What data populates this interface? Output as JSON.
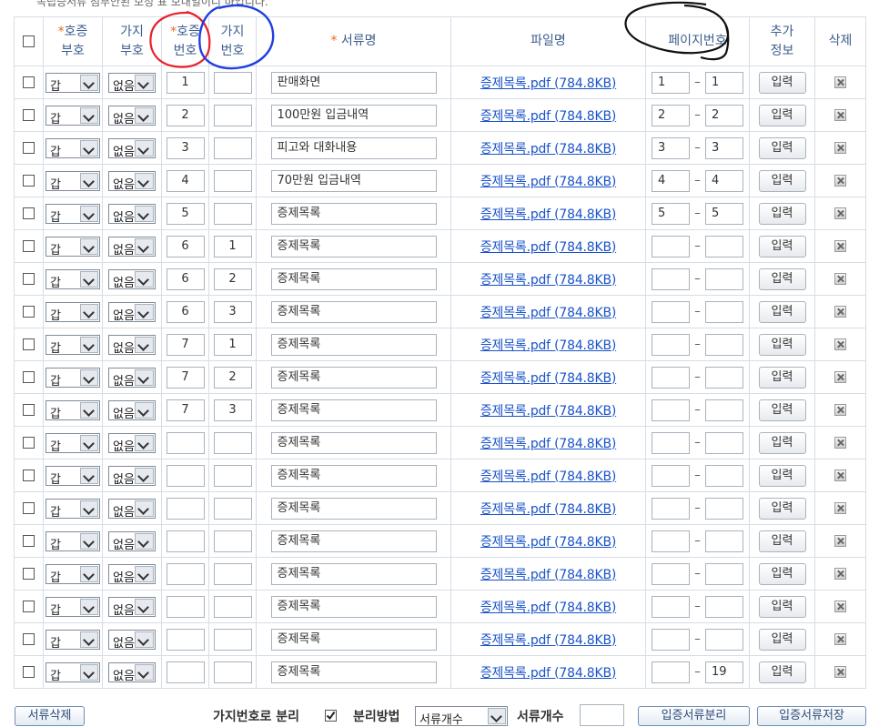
{
  "cutoff_text": "녹립증서류 첨부안된 보정 표 보내일이니 마입니다.",
  "columns": {
    "select_all": "",
    "code_prefix_req": "*",
    "code": [
      "호증",
      "부호"
    ],
    "branch_code": [
      "가지",
      "부호"
    ],
    "number_req": "*",
    "number": [
      "호증",
      "번호"
    ],
    "branch_number": [
      "가지",
      "번호"
    ],
    "doc_name_req": "*",
    "doc_name": "서류명",
    "file_name": "파일명",
    "page_number": "페이지번호",
    "extra_info": [
      "추가",
      "정보"
    ],
    "delete": "삭제"
  },
  "rows": [
    {
      "code": "갑",
      "branch": "없음",
      "num": "1",
      "bnum": "",
      "name": "판매화면",
      "file": "증제목록.pdf (784.8KB)",
      "pg_from": "1",
      "pg_to": "1",
      "btn": "입력"
    },
    {
      "code": "갑",
      "branch": "없음",
      "num": "2",
      "bnum": "",
      "name": "100만원 입금내역",
      "file": "증제목록.pdf (784.8KB)",
      "pg_from": "2",
      "pg_to": "2",
      "btn": "입력"
    },
    {
      "code": "갑",
      "branch": "없음",
      "num": "3",
      "bnum": "",
      "name": "피고와 대화내용",
      "file": "증제목록.pdf (784.8KB)",
      "pg_from": "3",
      "pg_to": "3",
      "btn": "입력"
    },
    {
      "code": "갑",
      "branch": "없음",
      "num": "4",
      "bnum": "",
      "name": "70만원 입금내역",
      "file": "증제목록.pdf (784.8KB)",
      "pg_from": "4",
      "pg_to": "4",
      "btn": "입력"
    },
    {
      "code": "갑",
      "branch": "없음",
      "num": "5",
      "bnum": "",
      "name": "증제목록",
      "file": "증제목록.pdf (784.8KB)",
      "pg_from": "5",
      "pg_to": "5",
      "btn": "입력"
    },
    {
      "code": "갑",
      "branch": "없음",
      "num": "6",
      "bnum": "1",
      "name": "증제목록",
      "file": "증제목록.pdf (784.8KB)",
      "pg_from": "",
      "pg_to": "",
      "btn": "입력"
    },
    {
      "code": "갑",
      "branch": "없음",
      "num": "6",
      "bnum": "2",
      "name": "증제목록",
      "file": "증제목록.pdf (784.8KB)",
      "pg_from": "",
      "pg_to": "",
      "btn": "입력"
    },
    {
      "code": "갑",
      "branch": "없음",
      "num": "6",
      "bnum": "3",
      "name": "증제목록",
      "file": "증제목록.pdf (784.8KB)",
      "pg_from": "",
      "pg_to": "",
      "btn": "입력"
    },
    {
      "code": "갑",
      "branch": "없음",
      "num": "7",
      "bnum": "1",
      "name": "증제목록",
      "file": "증제목록.pdf (784.8KB)",
      "pg_from": "",
      "pg_to": "",
      "btn": "입력"
    },
    {
      "code": "갑",
      "branch": "없음",
      "num": "7",
      "bnum": "2",
      "name": "증제목록",
      "file": "증제목록.pdf (784.8KB)",
      "pg_from": "",
      "pg_to": "",
      "btn": "입력"
    },
    {
      "code": "갑",
      "branch": "없음",
      "num": "7",
      "bnum": "3",
      "name": "증제목록",
      "file": "증제목록.pdf (784.8KB)",
      "pg_from": "",
      "pg_to": "",
      "btn": "입력"
    },
    {
      "code": "갑",
      "branch": "없음",
      "num": "",
      "bnum": "",
      "name": "증제목록",
      "file": "증제목록.pdf (784.8KB)",
      "pg_from": "",
      "pg_to": "",
      "btn": "입력"
    },
    {
      "code": "갑",
      "branch": "없음",
      "num": "",
      "bnum": "",
      "name": "증제목록",
      "file": "증제목록.pdf (784.8KB)",
      "pg_from": "",
      "pg_to": "",
      "btn": "입력"
    },
    {
      "code": "갑",
      "branch": "없음",
      "num": "",
      "bnum": "",
      "name": "증제목록",
      "file": "증제목록.pdf (784.8KB)",
      "pg_from": "",
      "pg_to": "",
      "btn": "입력"
    },
    {
      "code": "갑",
      "branch": "없음",
      "num": "",
      "bnum": "",
      "name": "증제목록",
      "file": "증제목록.pdf (784.8KB)",
      "pg_from": "",
      "pg_to": "",
      "btn": "입력"
    },
    {
      "code": "갑",
      "branch": "없음",
      "num": "",
      "bnum": "",
      "name": "증제목록",
      "file": "증제목록.pdf (784.8KB)",
      "pg_from": "",
      "pg_to": "",
      "btn": "입력"
    },
    {
      "code": "갑",
      "branch": "없음",
      "num": "",
      "bnum": "",
      "name": "증제목록",
      "file": "증제목록.pdf (784.8KB)",
      "pg_from": "",
      "pg_to": "",
      "btn": "입력"
    },
    {
      "code": "갑",
      "branch": "없음",
      "num": "",
      "bnum": "",
      "name": "증제목록",
      "file": "증제목록.pdf (784.8KB)",
      "pg_from": "",
      "pg_to": "",
      "btn": "입력"
    },
    {
      "code": "갑",
      "branch": "없음",
      "num": "",
      "bnum": "",
      "name": "증제목록",
      "file": "증제목록.pdf (784.8KB)",
      "pg_from": "",
      "pg_to": "19",
      "btn": "입력"
    }
  ],
  "bottom": {
    "delete_docs": "서류삭제",
    "split_by_branch": "가지번호로 분리",
    "split_by_branch_checked": true,
    "split_method_label": "분리방법",
    "split_method_value": "서류개수",
    "doc_count_label": "서류개수",
    "doc_count_value": "",
    "split_button": "입증서류분리",
    "save_button": "입증서류저장"
  },
  "annotations": {
    "red_circle_color": "#e8202a",
    "blue_circle_color": "#1f3fe0",
    "black_circle_color": "#111111"
  }
}
